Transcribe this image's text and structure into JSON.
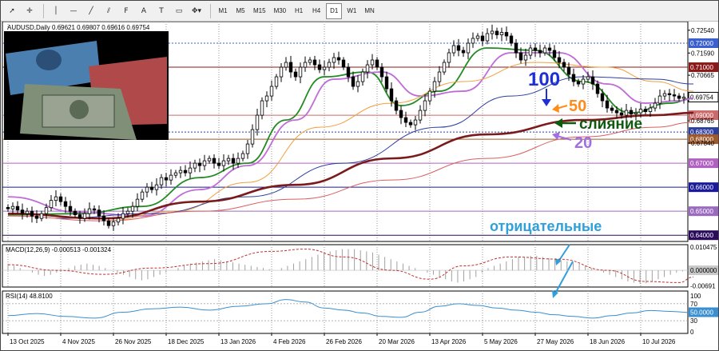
{
  "toolbar": {
    "tools": [
      {
        "name": "cursor-tool-icon",
        "glyph": "➚"
      },
      {
        "name": "crosshair-tool-icon",
        "glyph": "✛"
      },
      {
        "sep": true
      },
      {
        "name": "vertical-line-tool-icon",
        "glyph": "│"
      },
      {
        "name": "horizontal-line-tool-icon",
        "glyph": "—"
      },
      {
        "name": "trendline-tool-icon",
        "glyph": "╱"
      },
      {
        "name": "channel-tool-icon",
        "glyph": "⫽"
      },
      {
        "name": "fibonacci-tool-icon",
        "glyph": "F"
      },
      {
        "name": "text-tool-icon",
        "glyph": "A"
      },
      {
        "name": "text-label-tool-icon",
        "glyph": "T"
      },
      {
        "name": "rectangle-tool-icon",
        "glyph": "▭"
      },
      {
        "name": "shapes-dropdown-icon",
        "glyph": "✥▾"
      },
      {
        "sep": true
      }
    ],
    "timeframes": [
      "M1",
      "M5",
      "M15",
      "M30",
      "H1",
      "H4",
      "D1",
      "W1",
      "MN"
    ],
    "active_timeframe": "D1"
  },
  "colors": {
    "candle": "#000000",
    "ma20": "#228b22",
    "ma20_outer": "#c06cd8",
    "ma50": "#f0a040",
    "ma100": "#2e3ea0",
    "ma200": "#7a1a1a",
    "ma200b": "#d86060",
    "macd_hist": "#a0a0a0",
    "macd_signal": "#c03030",
    "rsi": "#3a8fd0",
    "annot_blue": "#1f2fd6",
    "annot_orange": "#ff8c1a",
    "annot_green": "#0f5a0f",
    "annot_purple": "#a070e0",
    "annot_cyan": "#2ea0dc"
  },
  "chart_data": {
    "type": "candlestick",
    "symbol_header": "AUDUSD,Daily  0.69621 0.69807 0.69616 0.69754",
    "last_price": "0.69754",
    "ylim": [
      0.6374,
      0.729
    ],
    "right_axis_ticks": [
      "0.72540",
      "0.72000",
      "0.71590",
      "0.71000",
      "0.70665",
      "0.69754",
      "0.69000",
      "0.68765",
      "0.68300",
      "0.68000",
      "0.67840",
      "0.67000",
      "0.66000",
      "0.65000",
      "0.64000"
    ],
    "horizontal_levels": [
      {
        "price": 0.72,
        "label": "0.72000",
        "color": "#3a5fd0",
        "style": "dotted",
        "label_bg": "#3a5fd0"
      },
      {
        "price": 0.71,
        "label": "0.71000",
        "color": "#8b1a1a",
        "style": "solid",
        "label_bg": "#8b1a1a"
      },
      {
        "price": 0.69,
        "label": "0.69000",
        "color": "#cc6a6a",
        "style": "solid",
        "label_bg": "#cc6a6a"
      },
      {
        "price": 0.683,
        "label": "0.68300",
        "color": "#2e3ea0",
        "style": "dotted",
        "label_bg": "#2e3ea0"
      },
      {
        "price": 0.68,
        "label": "0.68000",
        "color": "#a05a2a",
        "style": "solid",
        "label_bg": "#a05a2a"
      },
      {
        "price": 0.67,
        "label": "0.67000",
        "color": "#b060c0",
        "style": "solid",
        "label_bg": "#b060c0"
      },
      {
        "price": 0.66,
        "label": "0.66000",
        "color": "#1a1a9a",
        "style": "solid",
        "label_bg": "#1a1a9a"
      },
      {
        "price": 0.65,
        "label": "0.65000",
        "color": "#9a6ac0",
        "style": "solid",
        "label_bg": "#9a6ac0"
      },
      {
        "price": 0.64,
        "label": "0.64000",
        "color": "#2a0a5a",
        "style": "solid",
        "label_bg": "#2a0a5a"
      }
    ],
    "closes": [
      0.651,
      0.652,
      0.6505,
      0.649,
      0.65,
      0.648,
      0.647,
      0.649,
      0.6515,
      0.6545,
      0.656,
      0.654,
      0.652,
      0.65,
      0.6485,
      0.647,
      0.649,
      0.651,
      0.6505,
      0.648,
      0.646,
      0.644,
      0.6455,
      0.647,
      0.649,
      0.65,
      0.652,
      0.655,
      0.658,
      0.66,
      0.659,
      0.661,
      0.664,
      0.663,
      0.665,
      0.666,
      0.667,
      0.666,
      0.668,
      0.67,
      0.669,
      0.671,
      0.672,
      0.67,
      0.669,
      0.671,
      0.672,
      0.67,
      0.672,
      0.674,
      0.678,
      0.684,
      0.69,
      0.696,
      0.698,
      0.702,
      0.706,
      0.71,
      0.712,
      0.708,
      0.706,
      0.71,
      0.712,
      0.713,
      0.711,
      0.709,
      0.71,
      0.712,
      0.714,
      0.713,
      0.71,
      0.706,
      0.702,
      0.704,
      0.708,
      0.711,
      0.713,
      0.71,
      0.706,
      0.701,
      0.696,
      0.692,
      0.689,
      0.687,
      0.686,
      0.688,
      0.692,
      0.696,
      0.7,
      0.704,
      0.708,
      0.712,
      0.716,
      0.719,
      0.717,
      0.716,
      0.72,
      0.722,
      0.723,
      0.721,
      0.724,
      0.725,
      0.7235,
      0.7245,
      0.723,
      0.72,
      0.716,
      0.713,
      0.715,
      0.718,
      0.717,
      0.716,
      0.718,
      0.717,
      0.714,
      0.712,
      0.71,
      0.707,
      0.704,
      0.703,
      0.705,
      0.706,
      0.703,
      0.699,
      0.696,
      0.693,
      0.692,
      0.691,
      0.69,
      0.692,
      0.6905,
      0.691,
      0.6925,
      0.6915,
      0.693,
      0.695,
      0.698,
      0.699,
      0.6985,
      0.698,
      0.697,
      0.6975
    ],
    "ma_series": [
      {
        "key": "ma20",
        "width": 1.8,
        "points": [
          [
            0,
            0.6485
          ],
          [
            15,
            0.649
          ],
          [
            28,
            0.652
          ],
          [
            40,
            0.664
          ],
          [
            50,
            0.67
          ],
          [
            58,
            0.688
          ],
          [
            66,
            0.706
          ],
          [
            75,
            0.708
          ],
          [
            82,
            0.694
          ],
          [
            90,
            0.7
          ],
          [
            100,
            0.718
          ],
          [
            110,
            0.717
          ],
          [
            120,
            0.704
          ],
          [
            130,
            0.691
          ],
          [
            138,
            0.695
          ],
          [
            143,
            0.697
          ]
        ]
      },
      {
        "key": "ma20_outer",
        "width": 1.8,
        "points": [
          [
            0,
            0.656
          ],
          [
            15,
            0.6495
          ],
          [
            28,
            0.648
          ],
          [
            40,
            0.659
          ],
          [
            50,
            0.669
          ],
          [
            60,
            0.688
          ],
          [
            68,
            0.705
          ],
          [
            78,
            0.708
          ],
          [
            86,
            0.698
          ],
          [
            95,
            0.7
          ],
          [
            105,
            0.716
          ],
          [
            115,
            0.716
          ],
          [
            125,
            0.703
          ],
          [
            133,
            0.695
          ],
          [
            140,
            0.696
          ],
          [
            143,
            0.697
          ]
        ]
      },
      {
        "key": "ma50",
        "width": 1,
        "points": [
          [
            20,
            0.646
          ],
          [
            35,
            0.65
          ],
          [
            50,
            0.662
          ],
          [
            65,
            0.685
          ],
          [
            80,
            0.695
          ],
          [
            95,
            0.704
          ],
          [
            110,
            0.712
          ],
          [
            125,
            0.71
          ],
          [
            135,
            0.704
          ],
          [
            143,
            0.7
          ]
        ]
      },
      {
        "key": "ma100",
        "width": 1,
        "points": [
          [
            10,
            0.647
          ],
          [
            30,
            0.649
          ],
          [
            50,
            0.656
          ],
          [
            70,
            0.67
          ],
          [
            90,
            0.685
          ],
          [
            105,
            0.698
          ],
          [
            120,
            0.706
          ],
          [
            135,
            0.705
          ],
          [
            143,
            0.703
          ]
        ]
      },
      {
        "key": "ma200",
        "width": 2.6,
        "points": [
          [
            0,
            0.649
          ],
          [
            20,
            0.647
          ],
          [
            40,
            0.654
          ],
          [
            60,
            0.661
          ],
          [
            80,
            0.672
          ],
          [
            100,
            0.682
          ],
          [
            120,
            0.688
          ],
          [
            135,
            0.69
          ],
          [
            143,
            0.691
          ]
        ]
      },
      {
        "key": "ma200b",
        "width": 1,
        "points": [
          [
            0,
            0.648
          ],
          [
            20,
            0.646
          ],
          [
            40,
            0.65
          ],
          [
            60,
            0.655
          ],
          [
            80,
            0.663
          ],
          [
            100,
            0.672
          ],
          [
            120,
            0.681
          ],
          [
            135,
            0.685
          ],
          [
            143,
            0.687
          ]
        ]
      }
    ],
    "x_axis_dates": [
      "13 Oct 2025",
      "4 Nov 2025",
      "26 Nov 2025",
      "18 Dec 2025",
      "13 Jan 2026",
      "4 Feb 2026",
      "26 Feb 2026",
      "20 Mar 2026",
      "13 Apr 2026",
      "5 May 2026",
      "27 May 2026",
      "18 Jun 2026",
      "10 Jul 2026"
    ],
    "x_axis_date_index": [
      0,
      11,
      22,
      33,
      44,
      55,
      66,
      77,
      88,
      99,
      110,
      121,
      132
    ],
    "macd": {
      "label": "MACD(12,26,9) -0.000513 -0.001324",
      "params": "12,26,9",
      "value": -0.000513,
      "signal": -0.001324,
      "ylim": [
        -0.0075,
        0.0115
      ],
      "axis_ticks": [
        "0.010475",
        "0.000000",
        "-0.00691"
      ],
      "histogram": [
        0.003,
        0.002,
        0.001,
        0.0,
        -0.001,
        -0.002,
        -0.0025,
        -0.002,
        -0.001,
        0.0,
        0.001,
        0.002,
        0.0025,
        0.003,
        0.0025,
        0.002,
        0.001,
        0.0,
        -0.001,
        -0.002,
        -0.003,
        -0.004,
        -0.0045,
        -0.004,
        -0.003,
        -0.002,
        -0.001,
        0.0,
        0.001,
        0.002,
        0.003,
        0.0035,
        0.004,
        0.0045,
        0.005,
        0.0045,
        0.004,
        0.0035,
        0.003,
        0.0025,
        0.002,
        0.0015,
        0.001,
        0.0005,
        0.0,
        0.001,
        0.002,
        0.003,
        0.004,
        0.005,
        0.006,
        0.007,
        0.008,
        0.0085,
        0.009,
        0.0095,
        0.0095,
        0.0095,
        0.009,
        0.0085,
        0.008,
        0.007,
        0.006,
        0.005,
        0.004,
        0.003,
        0.002,
        0.001,
        0.0,
        -0.001,
        -0.002,
        -0.003,
        -0.004,
        -0.005,
        -0.0055,
        -0.005,
        -0.004,
        -0.003,
        -0.001,
        0.001,
        0.002,
        0.003,
        0.004,
        0.005,
        0.006,
        0.006,
        0.0065,
        0.0065,
        0.006,
        0.0055,
        0.005,
        0.0045,
        0.004,
        0.0035,
        0.003,
        0.002,
        0.001,
        0.0,
        -0.001,
        -0.002,
        -0.003,
        -0.004,
        -0.005,
        -0.0055,
        -0.006,
        -0.0058,
        -0.005,
        -0.004,
        -0.003,
        -0.002,
        -0.001,
        -0.0005
      ],
      "signal_line": [
        [
          0,
          0.0025
        ],
        [
          10,
          0.0
        ],
        [
          20,
          -0.0018
        ],
        [
          30,
          0.001
        ],
        [
          42,
          0.003
        ],
        [
          55,
          0.0085
        ],
        [
          62,
          0.0095
        ],
        [
          70,
          0.006
        ],
        [
          80,
          0.0
        ],
        [
          88,
          -0.004
        ],
        [
          95,
          0.002
        ],
        [
          105,
          0.006
        ],
        [
          115,
          0.005
        ],
        [
          125,
          0.0
        ],
        [
          133,
          -0.005
        ],
        [
          140,
          -0.0055
        ],
        [
          143,
          -0.003
        ]
      ]
    },
    "rsi": {
      "label": "RSI(14) 48.8100",
      "period": 14,
      "value": 48.81,
      "ylim": [
        0,
        100
      ],
      "axis_ticks": [
        "100",
        "70",
        "50.0000",
        "30",
        "0"
      ],
      "levels": [
        70,
        30
      ],
      "points": [
        [
          0,
          42
        ],
        [
          6,
          47
        ],
        [
          12,
          40
        ],
        [
          18,
          36
        ],
        [
          24,
          50
        ],
        [
          30,
          58
        ],
        [
          36,
          62
        ],
        [
          42,
          55
        ],
        [
          48,
          64
        ],
        [
          54,
          70
        ],
        [
          58,
          80
        ],
        [
          62,
          74
        ],
        [
          66,
          60
        ],
        [
          70,
          55
        ],
        [
          74,
          48
        ],
        [
          78,
          40
        ],
        [
          82,
          38
        ],
        [
          86,
          50
        ],
        [
          90,
          64
        ],
        [
          94,
          70
        ],
        [
          98,
          66
        ],
        [
          102,
          60
        ],
        [
          106,
          55
        ],
        [
          110,
          50
        ],
        [
          114,
          44
        ],
        [
          118,
          40
        ],
        [
          122,
          36
        ],
        [
          126,
          42
        ],
        [
          130,
          48
        ],
        [
          134,
          54
        ],
        [
          138,
          52
        ],
        [
          143,
          49
        ]
      ]
    },
    "annotations": [
      {
        "text": "100",
        "color_key": "annot_blue"
      },
      {
        "text": "50",
        "color_key": "annot_orange"
      },
      {
        "text": "слияние",
        "color_key": "annot_green"
      },
      {
        "text": "20",
        "color_key": "annot_purple"
      },
      {
        "text": "отрицательные",
        "color_key": "annot_cyan"
      }
    ]
  }
}
